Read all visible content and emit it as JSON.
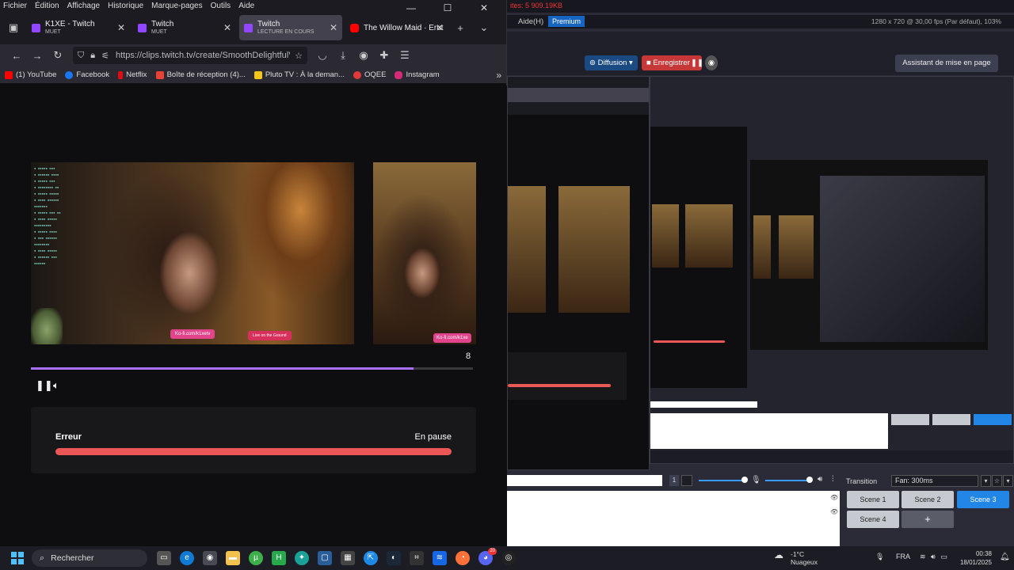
{
  "firefox": {
    "menu": [
      "Fichier",
      "Édition",
      "Affichage",
      "Historique",
      "Marque-pages",
      "Outils",
      "Aide"
    ],
    "window_controls": [
      "—",
      "☐",
      "✕"
    ],
    "tabs": [
      {
        "title": "K1XE - Twitch",
        "subtitle": "MUET",
        "icon": "twitch-icon"
      },
      {
        "title": "Twitch",
        "subtitle": "MUET",
        "icon": "twitch-icon"
      },
      {
        "title": "Twitch",
        "subtitle": "LECTURE EN COURS",
        "icon": "twitch-icon",
        "active": true
      },
      {
        "title": "The Willow Maid · Erut",
        "subtitle": "",
        "icon": "youtube-icon"
      }
    ],
    "url": "https://clips.twitch.tv/create/SmoothDelightfulVultureBudd",
    "bookmarks": [
      {
        "label": "(1) YouTube",
        "color": "#ff0000"
      },
      {
        "label": "Facebook",
        "color": "#1877f2"
      },
      {
        "label": "Netflix",
        "color": "#e50914"
      },
      {
        "label": "Boîte de réception (4)...",
        "color": "#ea4335"
      },
      {
        "label": "Pluto TV : À la deman...",
        "color": "#f5c518"
      },
      {
        "label": "OQEE",
        "color": "#e03a3a"
      },
      {
        "label": "Instagram",
        "color": "#d62976"
      }
    ],
    "clip": {
      "kofi_main": "Ko-fi.com/k1xetv",
      "kofi_side": "Ko-fi.com/k1xe",
      "live_tag": "Live on the Ground",
      "counter": "8",
      "progress_fraction": 0.865,
      "error_label": "Erreur",
      "status_label": "En pause"
    }
  },
  "obs": {
    "top_text": "ites: 5 909.19KB",
    "menu_help": "Aide(H)",
    "premium": "Premium",
    "resolution": "1280 x 720 @ 30,00 fps (Par défaut), 103%",
    "diffusion": "Diffusion",
    "enregistrer": "Enregistrer",
    "assistant": "Assistant de mise en page",
    "transition_label": "Transition",
    "fade": "Fan: 300ms",
    "scene_counter": "1",
    "scenes": [
      "Scene 1",
      "Scene 2",
      "Scene 3",
      "Scene 4",
      "+"
    ],
    "active_scene": "Scene 3"
  },
  "taskbar": {
    "search_placeholder": "Rechercher",
    "weather_temp": "-1°C",
    "weather_desc": "Nuageux",
    "language": "FRA",
    "time": "00:38",
    "date": "18/01/2025",
    "discord_badge": "20"
  }
}
